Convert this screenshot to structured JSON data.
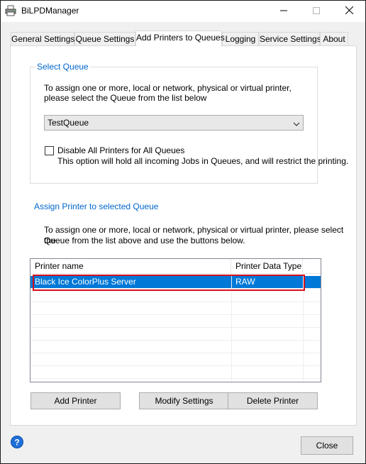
{
  "window": {
    "title": "BiLPDManager",
    "icons": {
      "app": "printer-icon",
      "minimize": "minimize-icon",
      "maximize": "maximize-icon",
      "close": "close-icon"
    }
  },
  "tabs": [
    {
      "label": "General Settings"
    },
    {
      "label": "Queue Settings"
    },
    {
      "label": "Add Printers to Queues",
      "active": true
    },
    {
      "label": "Logging"
    },
    {
      "label": "Service Settings"
    },
    {
      "label": "About"
    }
  ],
  "select_queue": {
    "legend": "Select Queue",
    "description_line1": "To assign one or more, local or network, physical or virtual printer,",
    "description_line2": "please select the Queue from the list below",
    "selected_queue": "TestQueue",
    "disable_all_label": "Disable All Printers for All Queues",
    "disable_all_checked": false,
    "disable_all_note": "This option will hold all incoming Jobs in Queues, and will restrict the printing."
  },
  "assign": {
    "title": "Assign Printer to selected Queue",
    "description_line1": "To assign one or more, local or network, physical or virtual printer, please select the",
    "description_line2": "Queue from the list above and use the buttons below."
  },
  "printer_list": {
    "columns": [
      "Printer name",
      "Printer Data Type"
    ],
    "rows": [
      {
        "name": "Black Ice ColorPlus Server",
        "type": "RAW",
        "selected": true
      }
    ],
    "highlight_color": "#d7101f",
    "selection_color": "#0078d7"
  },
  "buttons": {
    "add": "Add Printer",
    "modify": "Modify Settings",
    "delete": "Delete Printer",
    "close": "Close"
  },
  "colors": {
    "accent_blue": "#0066cc",
    "help_icon": "#1e6fd9"
  }
}
